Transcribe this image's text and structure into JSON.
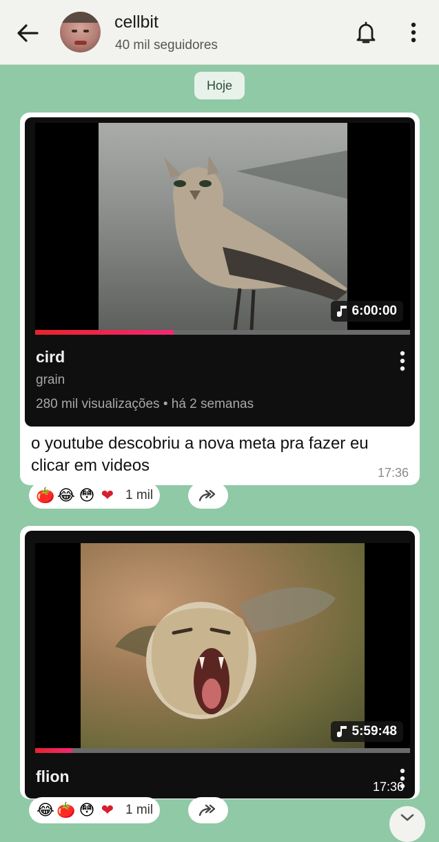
{
  "header": {
    "channel_name": "cellbit",
    "subscribers": "40 mil seguidores",
    "back_icon": "arrow-left-icon",
    "bell_icon": "bell-icon",
    "menu_icon": "more-vertical-icon"
  },
  "date_separator": "Hoje",
  "messages": [
    {
      "video": {
        "title": "cird",
        "channel": "grain",
        "views": "280 mil visualizações",
        "age": "há 2 semanas",
        "duration": "6:00:00",
        "progress": 0.37
      },
      "caption": "o youtube descobriu a nova meta pra fazer eu clicar em videos",
      "time": "17:36",
      "reactions": [
        "tomato",
        "joy",
        "flushed",
        "red-heart"
      ],
      "reaction_count": "1 mil"
    },
    {
      "video": {
        "title": "flion",
        "duration": "5:59:48",
        "progress": 0.1
      },
      "time": "17:36",
      "reactions": [
        "joy",
        "tomato",
        "flushed",
        "red-heart"
      ],
      "reaction_count": "1 mil"
    }
  ],
  "emoji_glyphs": {
    "tomato": "🍅",
    "joy": "😂",
    "flushed": "😳",
    "red-heart": "❤"
  },
  "colors": {
    "chat_background": "#8fc9a6",
    "progress_red": "#e8232b",
    "card_dark": "#0f0f0f"
  }
}
